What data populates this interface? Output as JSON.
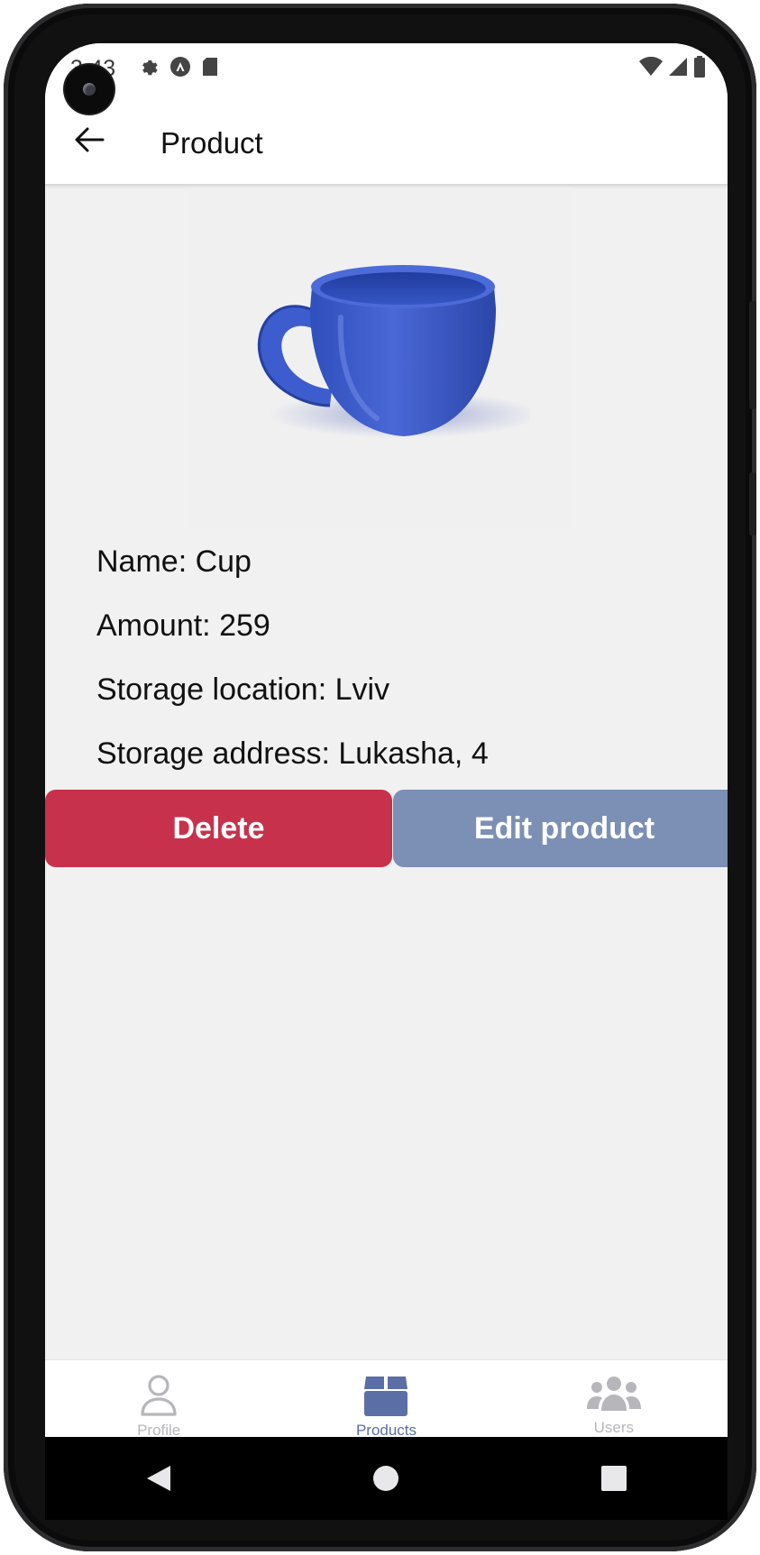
{
  "status_bar": {
    "time": "3:43",
    "left_icons": [
      "gear-icon",
      "a-badge-icon",
      "sd-card-icon"
    ],
    "right_icons": [
      "wifi-icon",
      "signal-icon",
      "battery-icon"
    ]
  },
  "header": {
    "back_icon": "arrow-left-icon",
    "title": "Product"
  },
  "product": {
    "image_icon": "blue-cup-image",
    "name_line": "Name: Cup",
    "amount_line": "Amount: 259",
    "location_line": "Storage location: Lviv",
    "address_line": "Storage address: Lukasha, 4"
  },
  "actions": {
    "delete_label": "Delete",
    "edit_label": "Edit product"
  },
  "tabs": [
    {
      "label": "Profile",
      "icon": "person-icon",
      "active": false
    },
    {
      "label": "Products",
      "icon": "box-icon",
      "active": true
    },
    {
      "label": "Users",
      "icon": "users-group-icon",
      "active": false
    }
  ],
  "colors": {
    "delete": "#c8314b",
    "edit": "#7c8fb4",
    "tab_active": "#5b6fa6",
    "tab_inactive": "#b7b7bb",
    "cup": "#3a5cc8"
  }
}
